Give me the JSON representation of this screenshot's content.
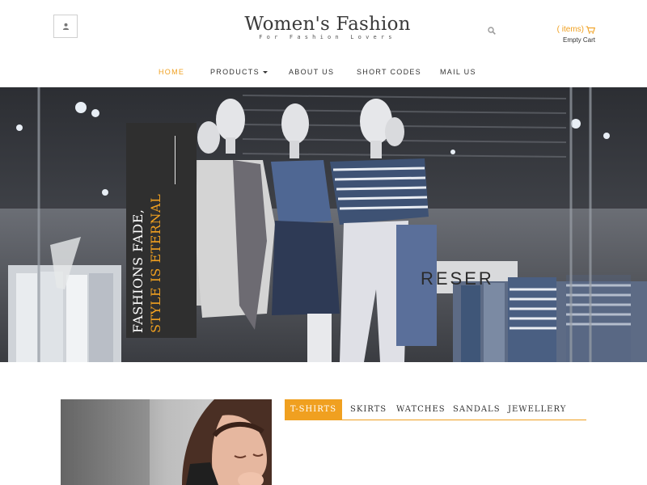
{
  "header": {
    "account_icon": "user-icon",
    "brand_title": "Women's Fashion",
    "brand_tagline": "For Fashion Lovers",
    "search_icon": "search-icon",
    "cart_items": "( items)",
    "cart_icon": "cart-icon",
    "cart_status": "Empty Cart"
  },
  "nav": {
    "items": [
      {
        "label": "HOME",
        "active": true
      },
      {
        "label": "PRODUCTS",
        "has_dropdown": true
      },
      {
        "label": "ABOUT US"
      },
      {
        "label": "SHORT CODES"
      },
      {
        "label": "MAIL US"
      }
    ]
  },
  "hero": {
    "line1": "FASHIONS FADE,",
    "line2": "STYLE IS ETERNAL"
  },
  "product_tabs": {
    "items": [
      {
        "label": "T-SHIRTS",
        "active": true
      },
      {
        "label": "SKIRTS"
      },
      {
        "label": "WATCHES"
      },
      {
        "label": "SANDALS"
      },
      {
        "label": "JEWELLERY"
      }
    ]
  },
  "colors": {
    "accent": "#f0a020",
    "text": "#333333",
    "hero_panel": "#2f2f2f"
  }
}
